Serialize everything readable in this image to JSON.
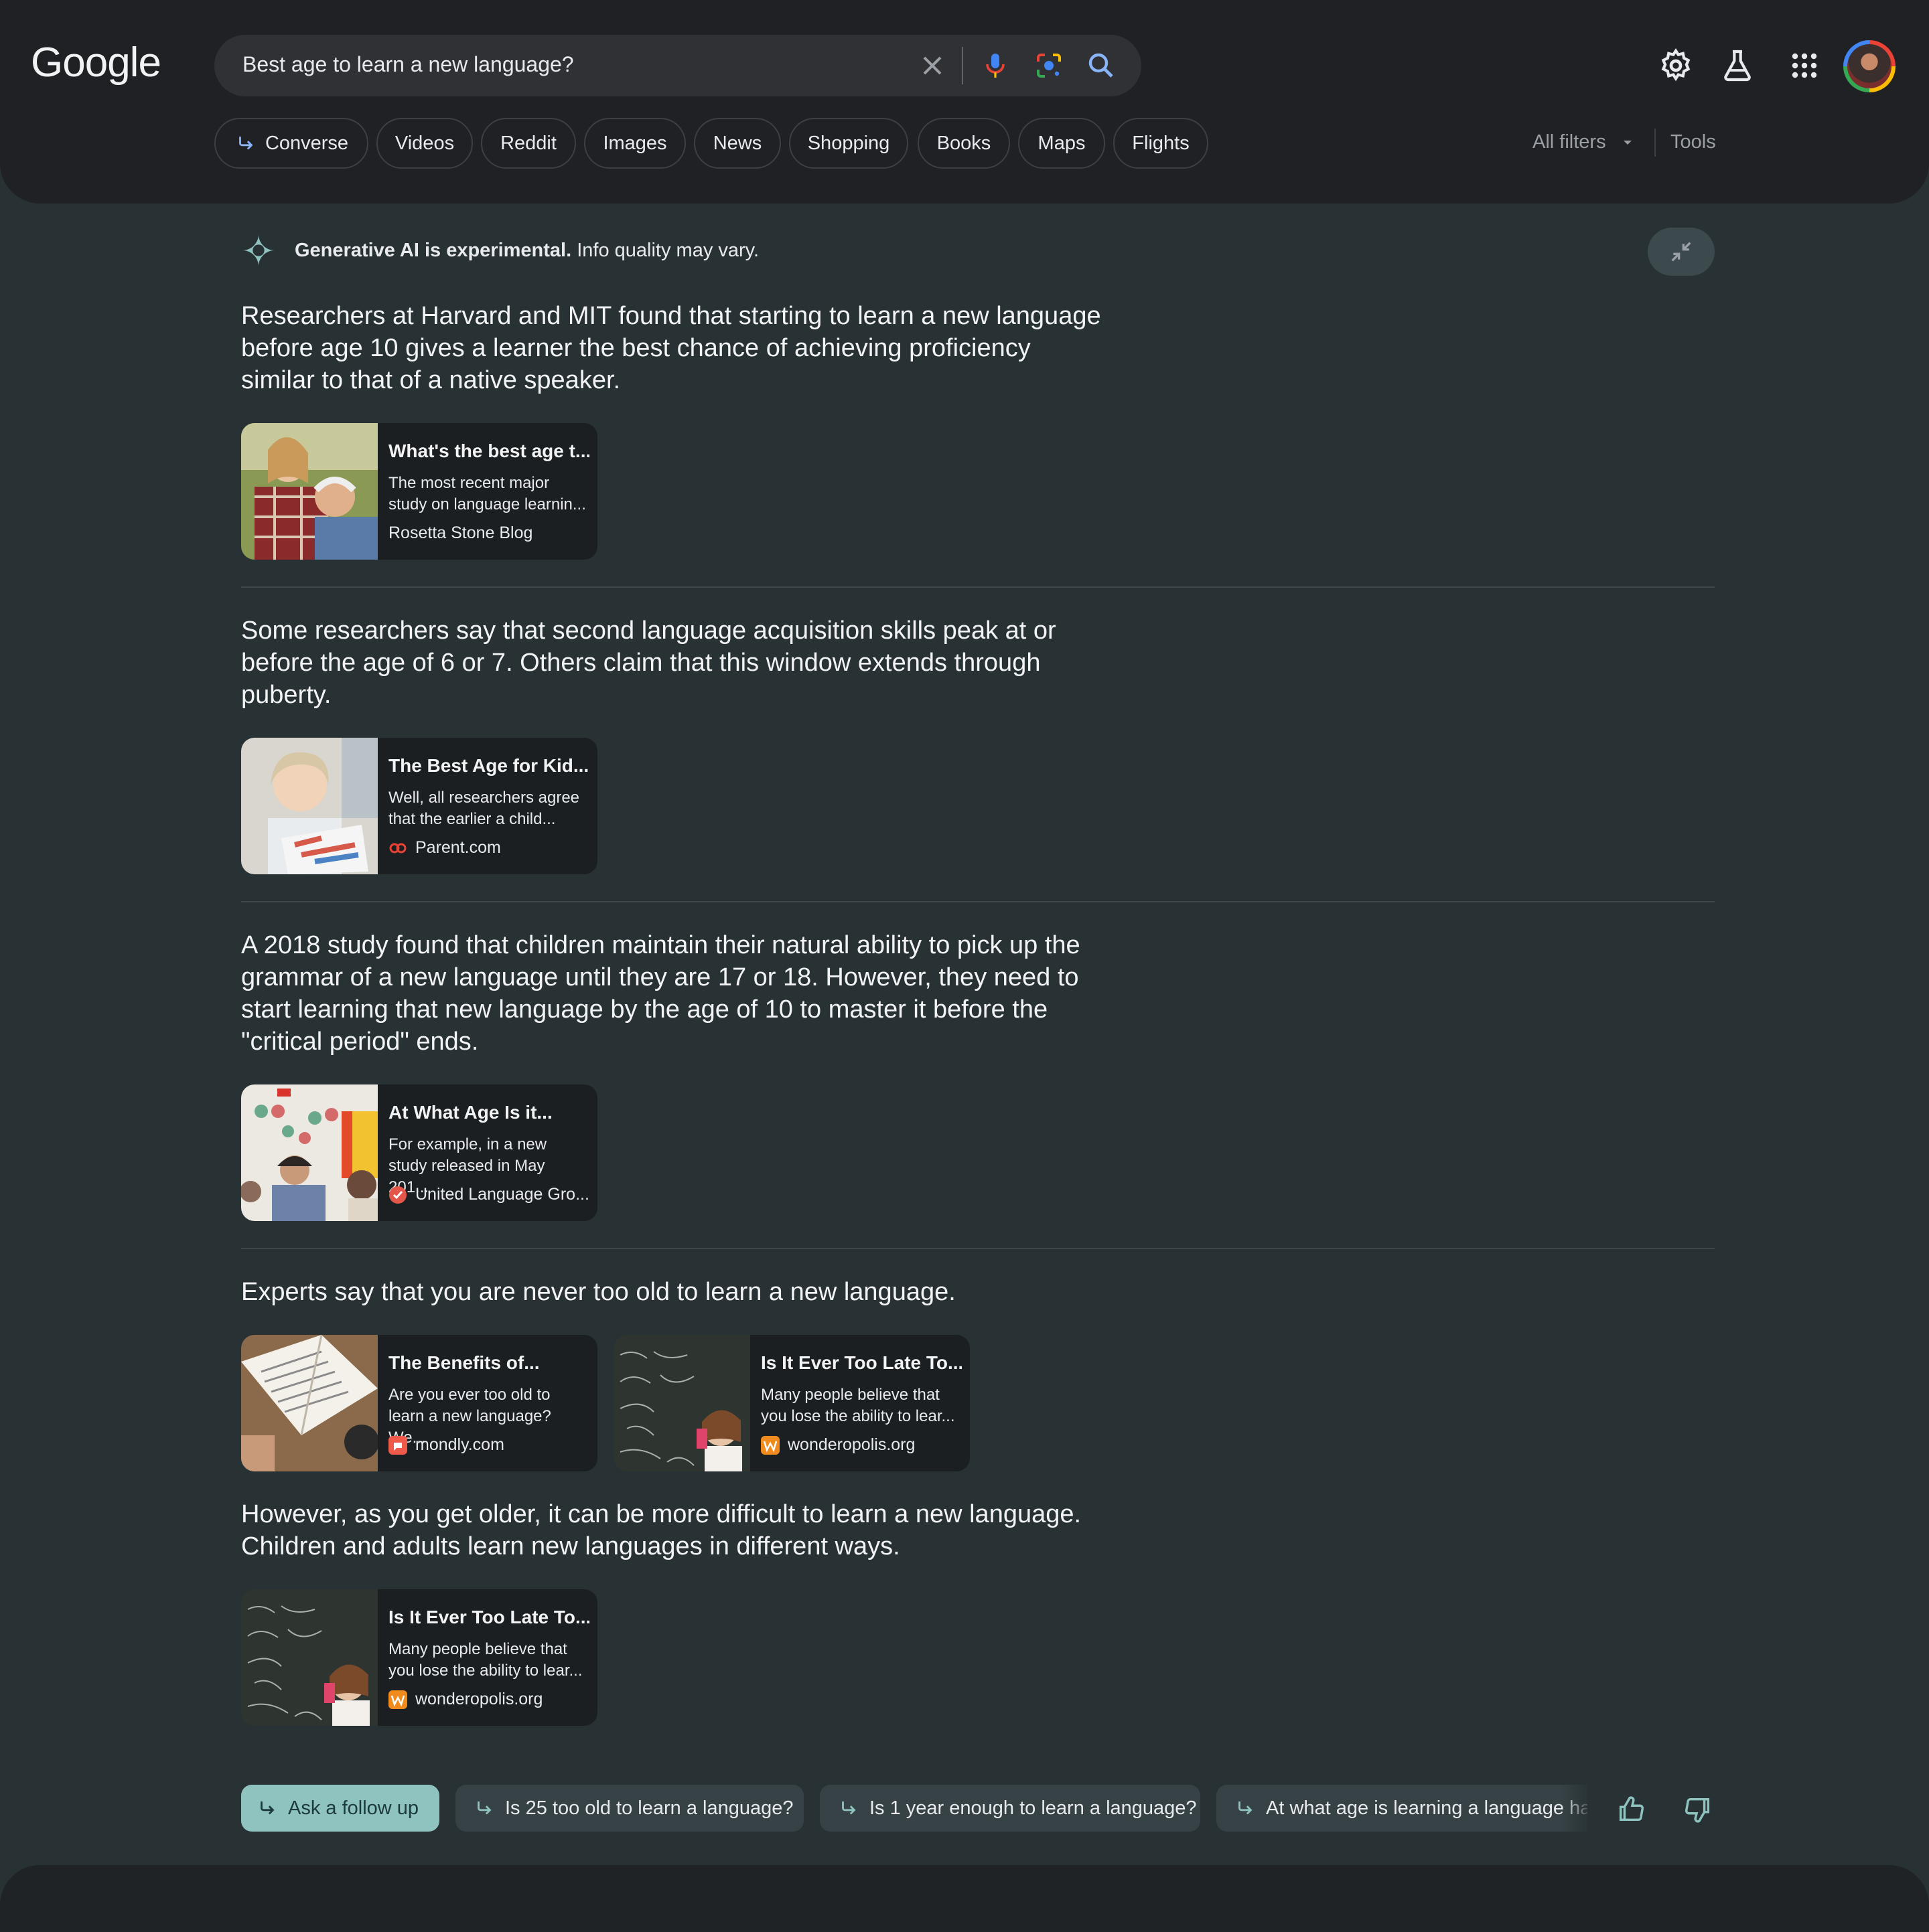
{
  "search": {
    "logo": "Google",
    "query": "Best age to learn a new language?"
  },
  "chips": [
    "Converse",
    "Videos",
    "Reddit",
    "Images",
    "News",
    "Shopping",
    "Books",
    "Maps",
    "Flights"
  ],
  "filters": {
    "all_filters": "All filters",
    "tools": "Tools"
  },
  "ai": {
    "notice_bold": "Generative AI is experimental.",
    "notice_rest": " Info quality may vary.",
    "sections": [
      {
        "text": "Researchers at Harvard and MIT found that starting to learn a new language before age 10 gives a learner the best chance of achieving proficiency similar to that of a native speaker.",
        "cards": [
          {
            "title": "What's the best age t...",
            "desc": "The most recent major study on language learnin...",
            "source": "Rosetta Stone Blog"
          }
        ]
      },
      {
        "text": "Some researchers say that second language acquisition skills peak at or before the age of 6 or 7. Others claim that this window extends through puberty.",
        "cards": [
          {
            "title": "The Best Age for Kid...",
            "desc": "Well, all researchers agree that the earlier a child...",
            "source": "Parent.com"
          }
        ]
      },
      {
        "text": "A 2018 study found that children maintain their natural ability to pick up the grammar of a new language until they are 17 or 18. However, they need to start learning that new language by the age of 10 to master it before the \"critical period\" ends.",
        "cards": [
          {
            "title": "At What Age Is it...",
            "desc": "For example, in a new study released in May 201...",
            "source": "United Language Gro..."
          }
        ]
      },
      {
        "text": "Experts say that you are never too old to learn a new language.",
        "cards": [
          {
            "title": "The Benefits of...",
            "desc": "Are you ever too old to learn a new language? We...",
            "source": "mondly.com"
          },
          {
            "title": "Is It Ever Too Late To...",
            "desc": "Many people believe that you lose the ability to lear...",
            "source": "wonderopolis.org"
          }
        ]
      },
      {
        "text": "However, as you get older, it can be more difficult to learn a new language. Children and adults learn new languages in different ways.",
        "cards": [
          {
            "title": "Is It Ever Too Late To...",
            "desc": "Many people believe that you lose the ability to lear...",
            "source": "wonderopolis.org"
          }
        ]
      }
    ]
  },
  "followups": {
    "ask": "Ask a follow up",
    "suggestions": [
      "Is 25 too old to learn a language?",
      "Is 1 year enough to learn a language?",
      "At what age is learning a language har"
    ]
  },
  "colors": {
    "background": "#283134",
    "header": "#202124",
    "accent": "#8ab4f8",
    "ask_button": "#8fc3c0"
  }
}
